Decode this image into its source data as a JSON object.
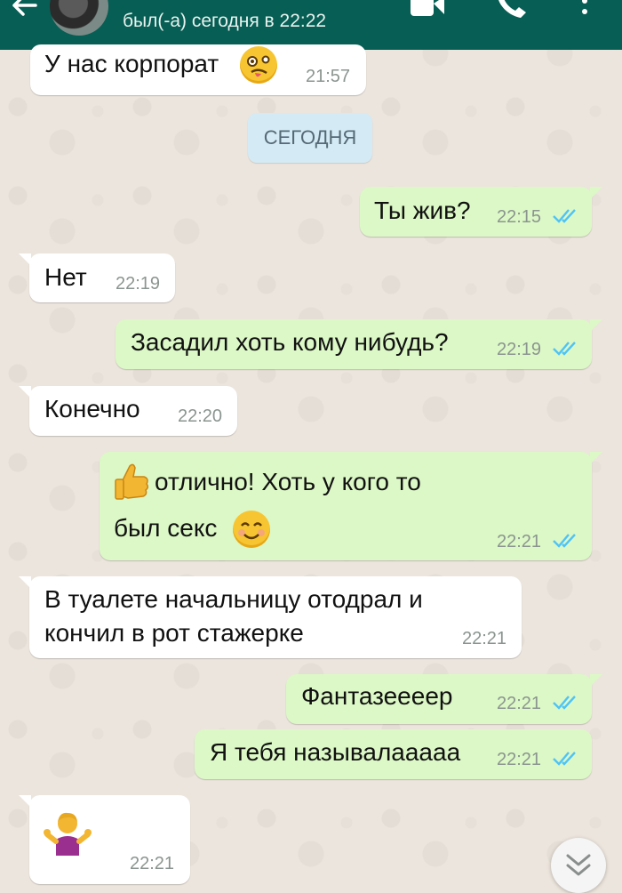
{
  "header": {
    "status": "был(-а) сегодня в 22:22"
  },
  "date_chip": "СЕГОДНЯ",
  "messages": [
    {
      "text": "У нас корпорат",
      "time": "21:57"
    },
    {
      "text": "Ты жив?",
      "time": "22:15"
    },
    {
      "text": "Нет",
      "time": "22:19"
    },
    {
      "text": "Засадил хоть кому нибудь?",
      "time": "22:19"
    },
    {
      "text": "Конечно",
      "time": "22:20"
    },
    {
      "line1": "отлично! Хоть у кого то",
      "line2": "был секс",
      "time": "22:21"
    },
    {
      "line1": "В туалете начальницу отодрал и",
      "line2": "кончил в рот стажерке",
      "time": "22:21"
    },
    {
      "text": "Фантазеееер",
      "time": "22:21"
    },
    {
      "text": "Я тебя называлааааа",
      "time": "22:21"
    },
    {
      "time": "22:21"
    }
  ],
  "colors": {
    "header": "#075e54",
    "outgoing_bubble": "#dcf8c6",
    "incoming_bubble": "#ffffff",
    "read_ticks": "#4fc3f7",
    "chat_background": "#ece5dd"
  },
  "icons": {
    "back": "arrow-left-icon",
    "video": "video-camera-icon",
    "call": "phone-icon",
    "menu": "more-vert-icon",
    "scroll": "chevron-double-down-icon"
  }
}
